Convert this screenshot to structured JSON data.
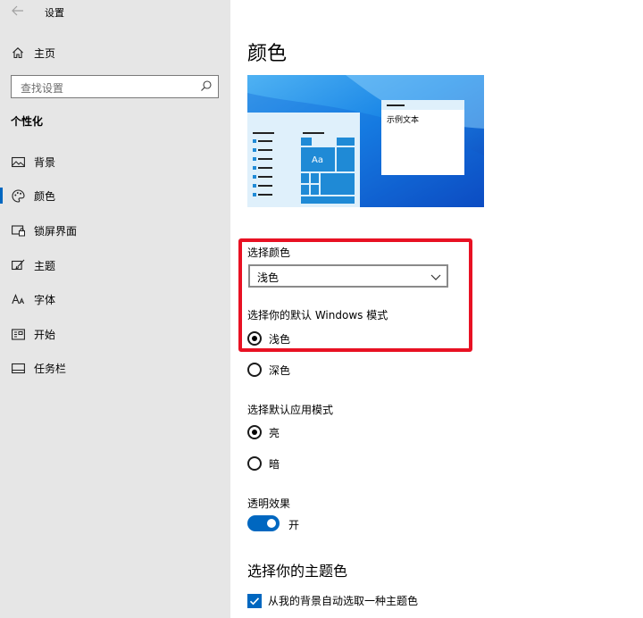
{
  "window": {
    "title": "设置"
  },
  "sidebar": {
    "home": "主页",
    "search_placeholder": "查找设置",
    "section": "个性化",
    "items": [
      {
        "label": "背景",
        "icon": "picture-icon"
      },
      {
        "label": "颜色",
        "icon": "palette-icon",
        "selected": true
      },
      {
        "label": "锁屏界面",
        "icon": "lock-screen-icon"
      },
      {
        "label": "主题",
        "icon": "theme-brush-icon"
      },
      {
        "label": "字体",
        "icon": "font-icon"
      },
      {
        "label": "开始",
        "icon": "start-menu-icon"
      },
      {
        "label": "任务栏",
        "icon": "taskbar-icon"
      }
    ]
  },
  "main": {
    "title": "颜色",
    "preview": {
      "sample_text": "示例文本",
      "tile_label": "Aa"
    },
    "choose_color": {
      "label": "选择颜色",
      "value": "浅色"
    },
    "windows_mode": {
      "label": "选择你的默认 Windows 模式",
      "options": [
        {
          "label": "浅色",
          "checked": true
        },
        {
          "label": "深色",
          "checked": false
        }
      ]
    },
    "app_mode": {
      "label": "选择默认应用模式",
      "options": [
        {
          "label": "亮",
          "checked": true
        },
        {
          "label": "暗",
          "checked": false
        }
      ]
    },
    "transparency": {
      "label": "透明效果",
      "state": "开",
      "on": true
    },
    "accent": {
      "title": "选择你的主题色",
      "auto_pick_label": "从我的背景自动选取一种主题色",
      "auto_pick_checked": true
    }
  },
  "colors": {
    "accent": "#0067c0",
    "highlight_border": "#e81123",
    "sidebar_bg": "#e6e6e6"
  }
}
